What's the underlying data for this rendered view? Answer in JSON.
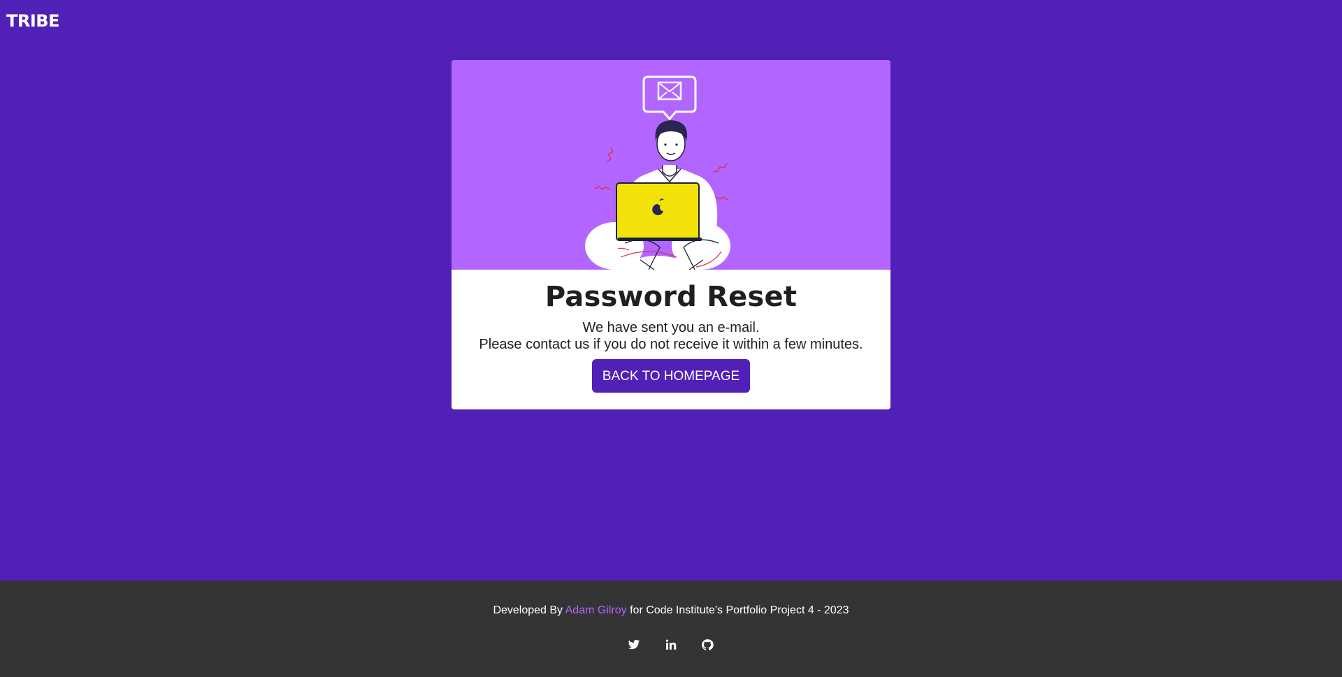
{
  "header": {
    "logo_text": "TRIBE"
  },
  "card": {
    "title": "Password Reset",
    "message_line1": "We have sent you an e-mail.",
    "message_line2": "Please contact us if you do not receive it within a few minutes.",
    "button_label": "BACK TO HOMEPAGE"
  },
  "footer": {
    "credit_prefix": "Developed By ",
    "author_name": "Adam Gilroy",
    "credit_suffix": " for Code Institute's Portfolio Project 4 - 2023",
    "social_icons": [
      "twitter-icon",
      "linkedin-icon",
      "github-icon"
    ]
  },
  "colors": {
    "page_background": "#5120b6",
    "hero_background": "#b266ff",
    "button_background": "#5120b6",
    "footer_background": "#343434",
    "author_link": "#b266ff",
    "laptop": "#f2e20a"
  }
}
